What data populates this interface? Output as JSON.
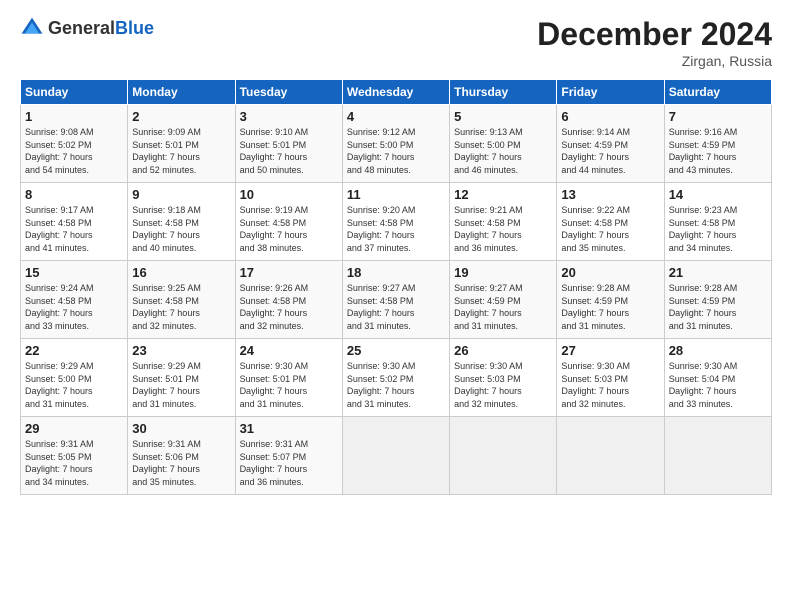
{
  "header": {
    "logo_general": "General",
    "logo_blue": "Blue",
    "title": "December 2024",
    "location": "Zirgan, Russia"
  },
  "days_of_week": [
    "Sunday",
    "Monday",
    "Tuesday",
    "Wednesday",
    "Thursday",
    "Friday",
    "Saturday"
  ],
  "weeks": [
    [
      {
        "day": "1",
        "info": "Sunrise: 9:08 AM\nSunset: 5:02 PM\nDaylight: 7 hours\nand 54 minutes."
      },
      {
        "day": "2",
        "info": "Sunrise: 9:09 AM\nSunset: 5:01 PM\nDaylight: 7 hours\nand 52 minutes."
      },
      {
        "day": "3",
        "info": "Sunrise: 9:10 AM\nSunset: 5:01 PM\nDaylight: 7 hours\nand 50 minutes."
      },
      {
        "day": "4",
        "info": "Sunrise: 9:12 AM\nSunset: 5:00 PM\nDaylight: 7 hours\nand 48 minutes."
      },
      {
        "day": "5",
        "info": "Sunrise: 9:13 AM\nSunset: 5:00 PM\nDaylight: 7 hours\nand 46 minutes."
      },
      {
        "day": "6",
        "info": "Sunrise: 9:14 AM\nSunset: 4:59 PM\nDaylight: 7 hours\nand 44 minutes."
      },
      {
        "day": "7",
        "info": "Sunrise: 9:16 AM\nSunset: 4:59 PM\nDaylight: 7 hours\nand 43 minutes."
      }
    ],
    [
      {
        "day": "8",
        "info": "Sunrise: 9:17 AM\nSunset: 4:58 PM\nDaylight: 7 hours\nand 41 minutes."
      },
      {
        "day": "9",
        "info": "Sunrise: 9:18 AM\nSunset: 4:58 PM\nDaylight: 7 hours\nand 40 minutes."
      },
      {
        "day": "10",
        "info": "Sunrise: 9:19 AM\nSunset: 4:58 PM\nDaylight: 7 hours\nand 38 minutes."
      },
      {
        "day": "11",
        "info": "Sunrise: 9:20 AM\nSunset: 4:58 PM\nDaylight: 7 hours\nand 37 minutes."
      },
      {
        "day": "12",
        "info": "Sunrise: 9:21 AM\nSunset: 4:58 PM\nDaylight: 7 hours\nand 36 minutes."
      },
      {
        "day": "13",
        "info": "Sunrise: 9:22 AM\nSunset: 4:58 PM\nDaylight: 7 hours\nand 35 minutes."
      },
      {
        "day": "14",
        "info": "Sunrise: 9:23 AM\nSunset: 4:58 PM\nDaylight: 7 hours\nand 34 minutes."
      }
    ],
    [
      {
        "day": "15",
        "info": "Sunrise: 9:24 AM\nSunset: 4:58 PM\nDaylight: 7 hours\nand 33 minutes."
      },
      {
        "day": "16",
        "info": "Sunrise: 9:25 AM\nSunset: 4:58 PM\nDaylight: 7 hours\nand 32 minutes."
      },
      {
        "day": "17",
        "info": "Sunrise: 9:26 AM\nSunset: 4:58 PM\nDaylight: 7 hours\nand 32 minutes."
      },
      {
        "day": "18",
        "info": "Sunrise: 9:27 AM\nSunset: 4:58 PM\nDaylight: 7 hours\nand 31 minutes."
      },
      {
        "day": "19",
        "info": "Sunrise: 9:27 AM\nSunset: 4:59 PM\nDaylight: 7 hours\nand 31 minutes."
      },
      {
        "day": "20",
        "info": "Sunrise: 9:28 AM\nSunset: 4:59 PM\nDaylight: 7 hours\nand 31 minutes."
      },
      {
        "day": "21",
        "info": "Sunrise: 9:28 AM\nSunset: 4:59 PM\nDaylight: 7 hours\nand 31 minutes."
      }
    ],
    [
      {
        "day": "22",
        "info": "Sunrise: 9:29 AM\nSunset: 5:00 PM\nDaylight: 7 hours\nand 31 minutes."
      },
      {
        "day": "23",
        "info": "Sunrise: 9:29 AM\nSunset: 5:01 PM\nDaylight: 7 hours\nand 31 minutes."
      },
      {
        "day": "24",
        "info": "Sunrise: 9:30 AM\nSunset: 5:01 PM\nDaylight: 7 hours\nand 31 minutes."
      },
      {
        "day": "25",
        "info": "Sunrise: 9:30 AM\nSunset: 5:02 PM\nDaylight: 7 hours\nand 31 minutes."
      },
      {
        "day": "26",
        "info": "Sunrise: 9:30 AM\nSunset: 5:03 PM\nDaylight: 7 hours\nand 32 minutes."
      },
      {
        "day": "27",
        "info": "Sunrise: 9:30 AM\nSunset: 5:03 PM\nDaylight: 7 hours\nand 32 minutes."
      },
      {
        "day": "28",
        "info": "Sunrise: 9:30 AM\nSunset: 5:04 PM\nDaylight: 7 hours\nand 33 minutes."
      }
    ],
    [
      {
        "day": "29",
        "info": "Sunrise: 9:31 AM\nSunset: 5:05 PM\nDaylight: 7 hours\nand 34 minutes."
      },
      {
        "day": "30",
        "info": "Sunrise: 9:31 AM\nSunset: 5:06 PM\nDaylight: 7 hours\nand 35 minutes."
      },
      {
        "day": "31",
        "info": "Sunrise: 9:31 AM\nSunset: 5:07 PM\nDaylight: 7 hours\nand 36 minutes."
      },
      {
        "day": "",
        "info": ""
      },
      {
        "day": "",
        "info": ""
      },
      {
        "day": "",
        "info": ""
      },
      {
        "day": "",
        "info": ""
      }
    ]
  ]
}
